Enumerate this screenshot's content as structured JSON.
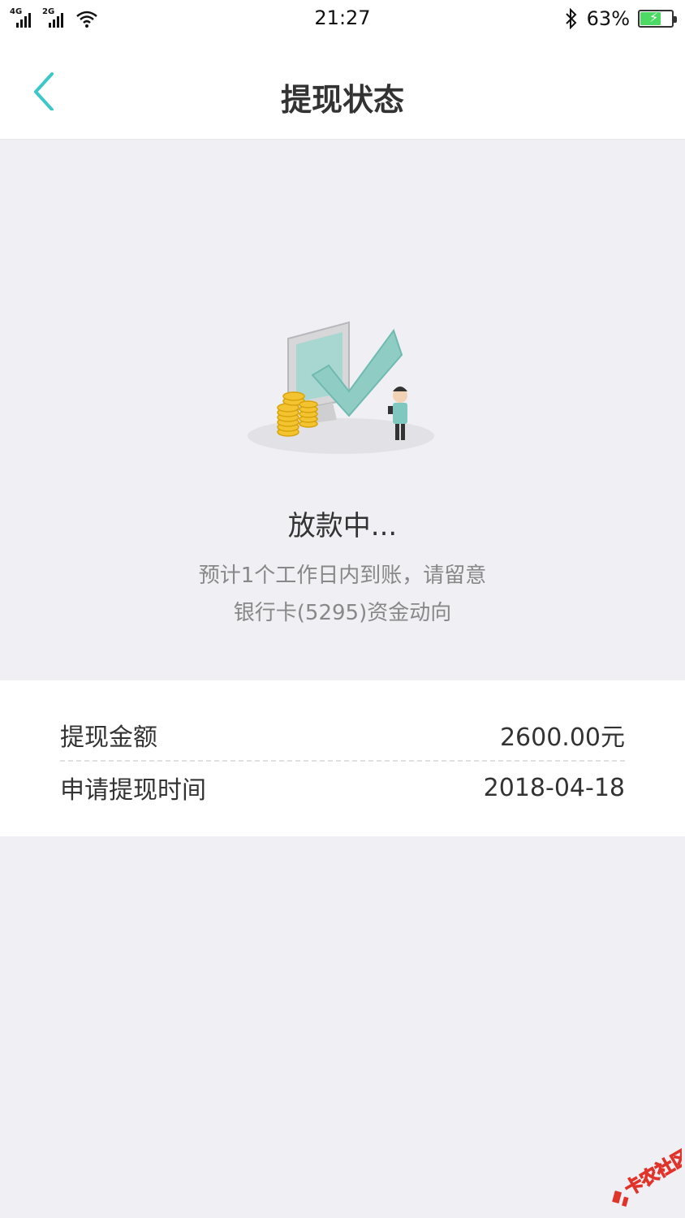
{
  "status_bar": {
    "network_1": "4G",
    "network_2": "2G",
    "time": "21:27",
    "battery_percent": "63%",
    "battery_level": 0.63,
    "icons": [
      "signal-4g-icon",
      "signal-2g-icon",
      "wifi-icon",
      "bluetooth-icon",
      "battery-icon"
    ]
  },
  "nav": {
    "title": "提现状态",
    "back_icon": "chevron-left-icon"
  },
  "status": {
    "title": "放款中...",
    "desc_line1": "预计1个工作日内到账，请留意",
    "desc_line2": "银行卡(5295)资金动向"
  },
  "details": {
    "amount_label": "提现金额",
    "amount_value": "2600.00元",
    "date_label": "申请提现时间",
    "date_value": "2018-04-18"
  },
  "watermark": {
    "text": "卡农社区"
  },
  "colors": {
    "accent": "#3cc8c8",
    "background": "#efeff4",
    "card": "#ffffff",
    "text_primary": "#333333",
    "text_secondary": "#888888"
  }
}
